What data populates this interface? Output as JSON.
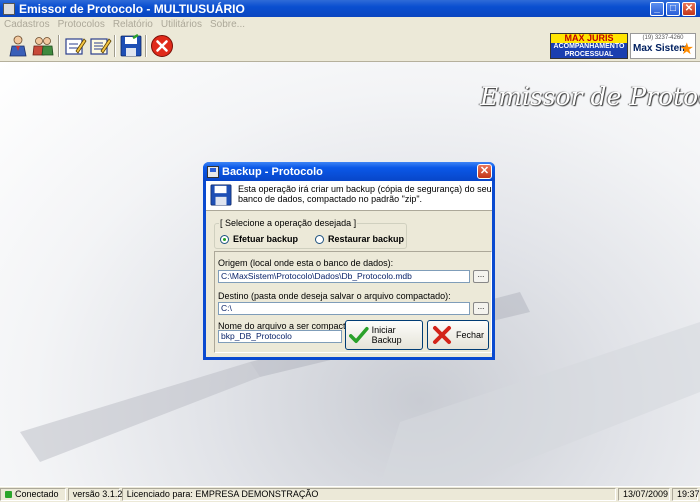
{
  "window": {
    "title": "Emissor de Protocolo - MULTIUSUÁRIO"
  },
  "menu": [
    "Cadastros",
    "Protocolos",
    "Relatório",
    "Utilitários",
    "Sobre..."
  ],
  "toolbar": {
    "icons": [
      "users-icon",
      "user-group-icon",
      "edit-form-icon",
      "edit-list-icon",
      "save-floppy-icon",
      "exit-x-icon"
    ]
  },
  "logos": {
    "maxjuris_title": "MAX JURIS",
    "maxjuris_line1": "ACOMPANHAMENTO",
    "maxjuris_line2": "PROCESSUAL",
    "maxsistem_phone": "(19) 3237-4260",
    "maxsistem_name": "Max Sistem"
  },
  "background": {
    "watermark": "Emissor de Protocolos"
  },
  "dialog": {
    "title": "Backup - Protocolo",
    "info_text": "Esta operação irá criar um backup (cópia de segurança) do seu banco de dados, compactado no padrão \"zip\".",
    "operation_legend": "[ Selecione a operação desejada ]",
    "radio_backup": "Efetuar backup",
    "radio_restore": "Restaurar backup",
    "selected_operation": "Efetuar backup",
    "origin_label": "Origem (local onde esta o banco de dados):",
    "origin_value": "C:\\MaxSistem\\Protocolo\\Dados\\Db_Protocolo.mdb",
    "dest_label": "Destino (pasta onde deseja salvar o arquivo compactado):",
    "dest_value": "C:\\",
    "filename_label": "Nome do arquivo a ser compactado:",
    "filename_value": "bkp_DB_Protocolo",
    "browse_label": "...",
    "start_button": "Iniciar Backup",
    "close_button": "Fechar"
  },
  "status": {
    "connection": "Conectado",
    "version": "versão 3.1.2",
    "license": "Licenciado para: EMPRESA DEMONSTRAÇÃO",
    "date": "13/07/2009",
    "time": "19:37"
  }
}
